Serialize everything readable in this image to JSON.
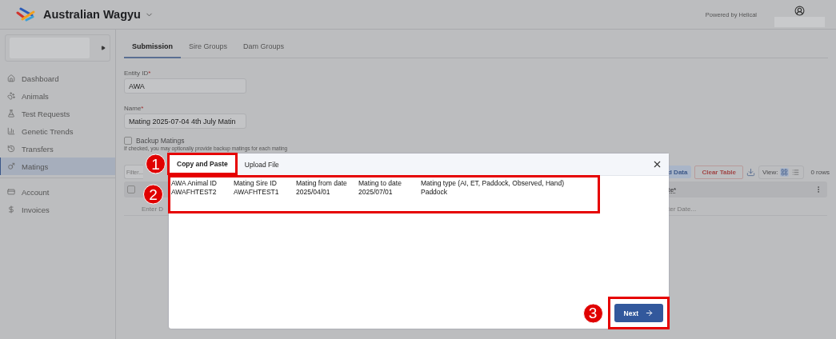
{
  "header": {
    "app_name": "Australian Wagyu",
    "powered_by": "Powered by Helical"
  },
  "sidebar": {
    "sections": [
      [
        {
          "label": "Dashboard",
          "selected": false
        },
        {
          "label": "Animals",
          "selected": false
        },
        {
          "label": "Test Requests",
          "selected": false
        },
        {
          "label": "Genetic Trends",
          "selected": false
        },
        {
          "label": "Transfers",
          "selected": false
        },
        {
          "label": "Matings",
          "selected": true
        }
      ],
      [
        {
          "label": "Account",
          "selected": false
        },
        {
          "label": "Invoices",
          "selected": false
        }
      ]
    ]
  },
  "tabs": [
    {
      "label": "Submission",
      "selected": true
    },
    {
      "label": "Sire Groups",
      "selected": false
    },
    {
      "label": "Dam Groups",
      "selected": false
    }
  ],
  "form": {
    "fields": [
      {
        "label": "Entity ID",
        "mark": "*",
        "value": "AWA"
      },
      {
        "label": "Name",
        "mark": "*",
        "value": "Mating 2025-07-04 4th July Matin"
      }
    ],
    "backup": {
      "label": "Backup Matings",
      "checked": false,
      "hint": "If checked, you may optionally provide backup matings for each mating"
    }
  },
  "toolbar": {
    "filter_placeholder": "Filter...",
    "load_button": "d Data",
    "clear_button": "Clear Table",
    "view_label": "View:",
    "view_modes": [
      {
        "selected": true
      },
      {
        "selected": false
      }
    ],
    "row_count": "0 rows"
  },
  "table": {
    "select_all_checked": false,
    "header_right": "te*",
    "row_left": "Enter D",
    "row_right": "ter Date..."
  },
  "modal": {
    "tabs": [
      {
        "label": "Copy and Paste",
        "selected": true
      },
      {
        "label": "Upload File",
        "selected": false
      }
    ],
    "paste_lines": [
      "AWA Animal ID\tMating Sire ID\tMating from date\tMating to date\tMating type (AI, ET, Paddock, Observed, Hand)",
      "AWAFHTEST2\tAWAFHTEST1\t2025/04/01\t2025/07/01\tPaddock"
    ],
    "next_button": "Next"
  },
  "annotations": [
    {
      "number": "1"
    },
    {
      "number": "2"
    },
    {
      "number": "3"
    }
  ]
}
